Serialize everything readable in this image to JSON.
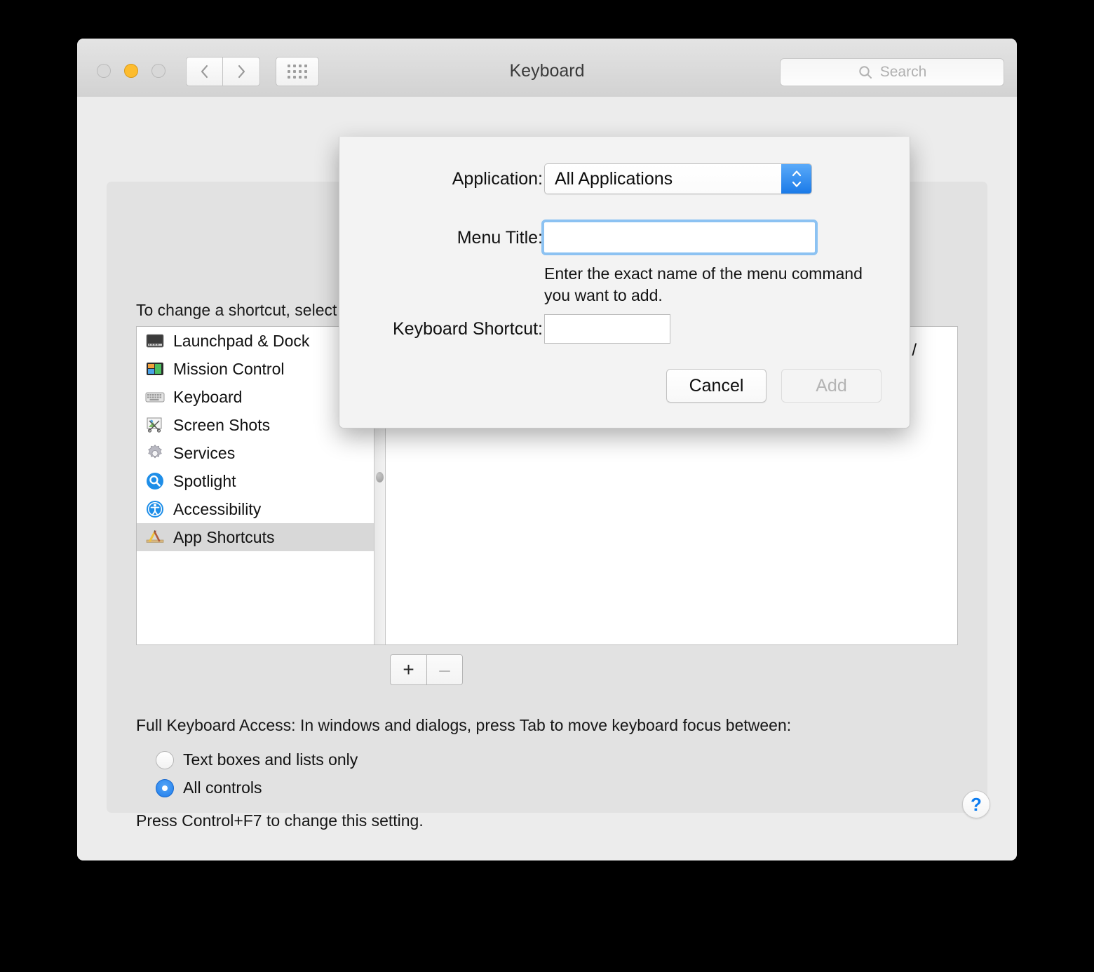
{
  "window": {
    "title": "Keyboard",
    "traffic_lights": [
      "close",
      "minimize",
      "maximize"
    ],
    "nav": {
      "back": "‹",
      "forward": "›",
      "grid": "grid"
    },
    "search": {
      "placeholder": "Search",
      "value": ""
    }
  },
  "main": {
    "intro": "To change a shortcut, select it, click the key combination, and then type new keys.",
    "list": {
      "items": [
        {
          "label": "Launchpad & Dock",
          "icon": "launchpad-icon",
          "selected": false
        },
        {
          "label": "Mission Control",
          "icon": "mission-control-icon",
          "selected": false
        },
        {
          "label": "Keyboard",
          "icon": "keyboard-icon",
          "selected": false
        },
        {
          "label": "Screen Shots",
          "icon": "screenshots-icon",
          "selected": false
        },
        {
          "label": "Services",
          "icon": "services-gear-icon",
          "selected": false
        },
        {
          "label": "Spotlight",
          "icon": "spotlight-icon",
          "selected": false
        },
        {
          "label": "Accessibility",
          "icon": "accessibility-icon",
          "selected": false
        },
        {
          "label": "App Shortcuts",
          "icon": "app-shortcuts-icon",
          "selected": true
        }
      ]
    },
    "shortcut_entry": {
      "keys": "⇧⌘/"
    },
    "add_remove": {
      "add": "+",
      "remove": "–"
    },
    "full_keyboard_access": {
      "title": "Full Keyboard Access: In windows and dialogs, press Tab to move keyboard focus between:",
      "options": [
        {
          "label": "Text boxes and lists only",
          "selected": false
        },
        {
          "label": "All controls",
          "selected": true
        }
      ],
      "note": "Press Control+F7 to change this setting."
    },
    "help": "?"
  },
  "sheet": {
    "application_label": "Application:",
    "application_value": "All Applications",
    "menu_title_label": "Menu Title:",
    "menu_title_value": "",
    "menu_title_placeholder": "",
    "help_text": "Enter the exact name of the menu command you want to add.",
    "keyboard_shortcut_label": "Keyboard Shortcut:",
    "keyboard_shortcut_value": "",
    "keyboard_shortcut_placeholder": "",
    "cancel_label": "Cancel",
    "add_label": "Add"
  },
  "colors": {
    "accent_blue": "#1a7ae8",
    "focus_ring": "#8cc2f2",
    "selection_gray": "#d8d8d8",
    "window_bg": "#ececec",
    "panel_bg": "#e2e2e2",
    "help_blue": "#0a7bf0"
  }
}
